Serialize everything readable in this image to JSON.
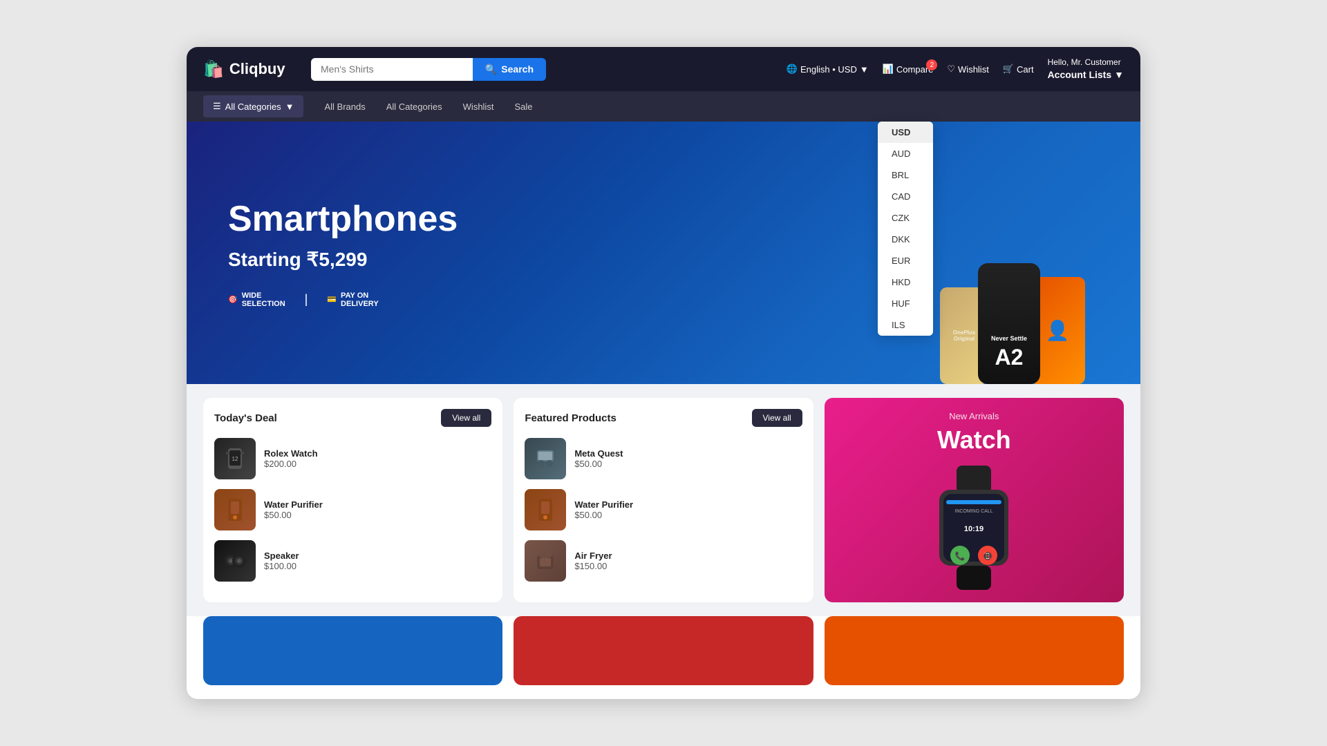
{
  "header": {
    "logo_text": "Cliqbuy",
    "search_placeholder": "Men's Shirts",
    "search_button": "Search",
    "language": "English • USD",
    "compare_label": "Compare",
    "compare_badge": "2",
    "wishlist_label": "Wishlist",
    "cart_label": "Cart",
    "user_hello": "Hello, Mr. Customer",
    "user_account": "Account Lists"
  },
  "nav": {
    "all_categories": "All Categories",
    "links": [
      "All Brands",
      "All Categories",
      "Wishlist",
      "Sale"
    ]
  },
  "hero": {
    "title": "Smartphones",
    "subtitle": "Starting ₹5,299",
    "feature1_line1": "WIDE",
    "feature1_line2": "SELECTION",
    "feature2_line1": "PAY ON",
    "feature2_line2": "DELIVERY",
    "never_settle": "Never Settle",
    "a2_text": "A2"
  },
  "currency_dropdown": {
    "options": [
      "USD",
      "AUD",
      "BRL",
      "CAD",
      "CZK",
      "DKK",
      "EUR",
      "HKD",
      "HUF",
      "ILS"
    ],
    "selected": "USD"
  },
  "todays_deal": {
    "title": "Today's Deal",
    "view_all": "View all",
    "items": [
      {
        "name": "Rolex Watch",
        "price": "$200.00"
      },
      {
        "name": "Water Purifier",
        "price": "$50.00"
      },
      {
        "name": "Speaker",
        "price": "$100.00"
      }
    ]
  },
  "featured_products": {
    "title": "Featured Products",
    "view_all": "View all",
    "items": [
      {
        "name": "Meta Quest",
        "price": "$50.00"
      },
      {
        "name": "Water Purifier",
        "price": "$50.00"
      },
      {
        "name": "Air Fryer",
        "price": "$150.00"
      }
    ]
  },
  "new_arrivals": {
    "label": "New Arrivals",
    "title": "Watch"
  }
}
